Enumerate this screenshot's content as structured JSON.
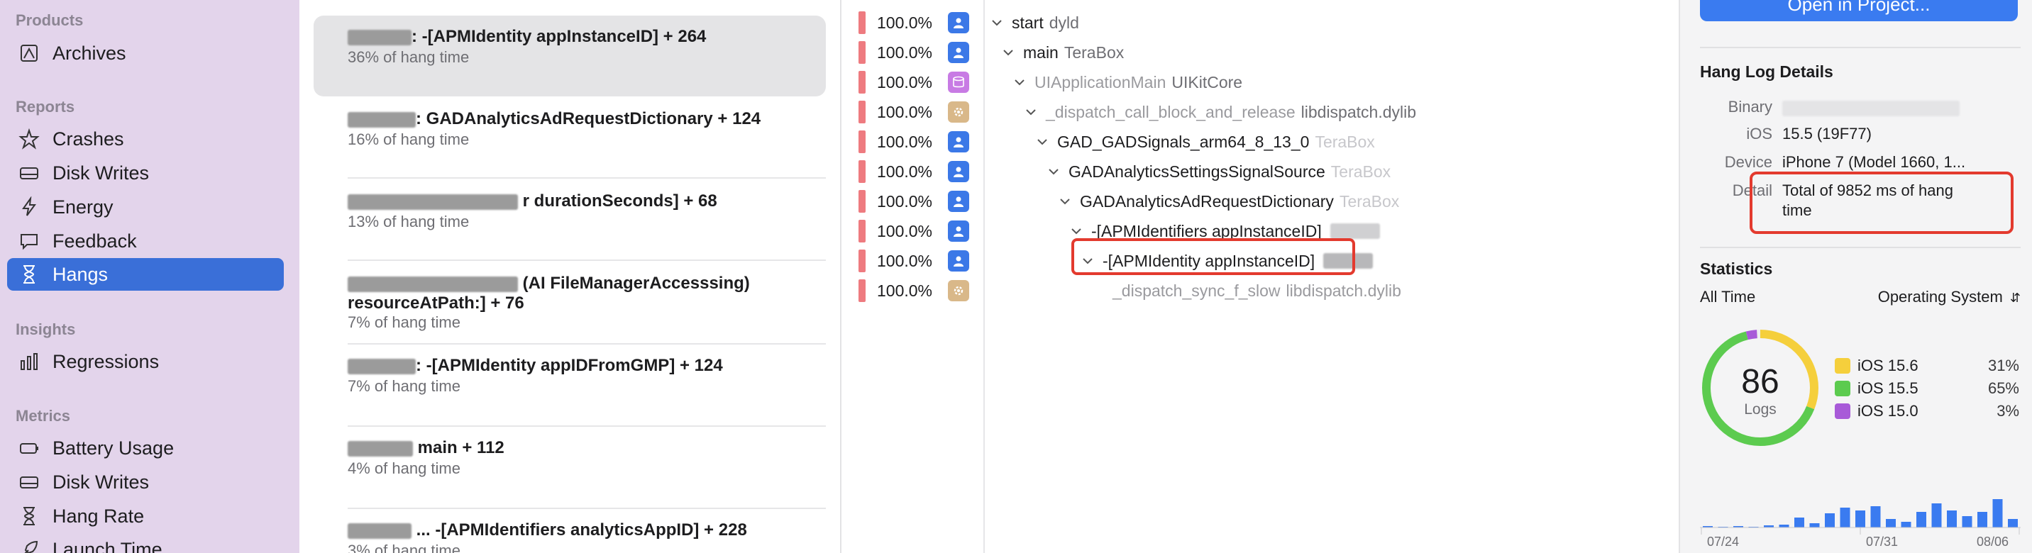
{
  "sidebar": {
    "products_title": "Products",
    "archives_label": "Archives",
    "reports_title": "Reports",
    "reports": [
      "Crashes",
      "Disk Writes",
      "Energy",
      "Feedback",
      "Hangs"
    ],
    "insights_title": "Insights",
    "regressions_label": "Regressions",
    "metrics_title": "Metrics",
    "metrics": [
      "Battery Usage",
      "Disk Writes",
      "Hang Rate",
      "Launch Time"
    ]
  },
  "hang_list": [
    {
      "title": ": -[APMIdentity appInstanceID] + 264",
      "sub": "36% of hang time"
    },
    {
      "title": ": GADAnalyticsAdRequestDictionary + 124",
      "sub": "16% of hang time"
    },
    {
      "title": "r durationSeconds] + 68",
      "sub": "13% of hang time"
    },
    {
      "title": "(AI FileManagerAccesssing)",
      "title2": "resourceAtPath:] + 76",
      "sub": "7% of hang time"
    },
    {
      "title": ": -[APMIdentity appIDFromGMP] + 124",
      "sub": "7% of hang time"
    },
    {
      "title": "main + 112",
      "sub": "4% of hang time"
    },
    {
      "title": "... -[APMIdentifiers analyticsAppID] + 228",
      "sub": "3% of hang time"
    }
  ],
  "percent_column": [
    {
      "pct": "100.0%",
      "icon": "user-icon"
    },
    {
      "pct": "100.0%",
      "icon": "user-icon"
    },
    {
      "pct": "100.0%",
      "icon": "library-icon"
    },
    {
      "pct": "100.0%",
      "icon": "gear-icon"
    },
    {
      "pct": "100.0%",
      "icon": "user-icon"
    },
    {
      "pct": "100.0%",
      "icon": "user-icon"
    },
    {
      "pct": "100.0%",
      "icon": "user-icon"
    },
    {
      "pct": "100.0%",
      "icon": "user-icon"
    },
    {
      "pct": "100.0%",
      "icon": "user-icon"
    },
    {
      "pct": "100.0%",
      "icon": "gear-icon"
    }
  ],
  "call_tree": [
    {
      "symbol": "start",
      "lib": "dyld"
    },
    {
      "symbol": "main",
      "lib": "TeraBox"
    },
    {
      "symbol": "UIApplicationMain",
      "lib": "UIKitCore"
    },
    {
      "symbol": "_dispatch_call_block_and_release",
      "lib": "libdispatch.dylib"
    },
    {
      "symbol": "GAD_GADSignals_arm64_8_13_0",
      "lib": "TeraBox"
    },
    {
      "symbol": "GADAnalyticsSettingsSignalSource",
      "lib": "TeraBox"
    },
    {
      "symbol": "GADAnalyticsAdRequestDictionary",
      "lib": "TeraBox"
    },
    {
      "symbol": "-[APMIdentifiers appInstanceID]",
      "lib": ""
    },
    {
      "symbol": "-[APMIdentity appInstanceID]",
      "lib": ""
    },
    {
      "symbol": "_dispatch_sync_f_slow",
      "lib": "libdispatch.dylib"
    }
  ],
  "inspector": {
    "open_button": "Open in Project...",
    "details_title": "Hang Log Details",
    "binary_label": "Binary",
    "ios_label": "iOS",
    "ios_value": "15.5 (19F77)",
    "device_label": "Device",
    "device_value": "iPhone 7 (Model 1660, 1...",
    "detail_label": "Detail",
    "detail_value_line1": "Total of 9852 ms of hang",
    "detail_value_line2": "time",
    "stats_title": "Statistics",
    "time_filter": "All Time",
    "group_filter": "Operating System",
    "logs_count": "86",
    "logs_label": "Logs",
    "legend": [
      {
        "name": "iOS 15.6",
        "pct": "31%",
        "color": "#f5cf3c"
      },
      {
        "name": "iOS 15.5",
        "pct": "65%",
        "color": "#5ccb4f"
      },
      {
        "name": "iOS 15.0",
        "pct": "3%",
        "color": "#a85ad8"
      }
    ],
    "histogram_ticks": [
      "07/24",
      "07/31",
      "08/06"
    ]
  },
  "colors": {
    "sidebar_bg": "#e3d4eb",
    "accent": "#3a6fd8",
    "highlight_red": "#e33a2e"
  }
}
